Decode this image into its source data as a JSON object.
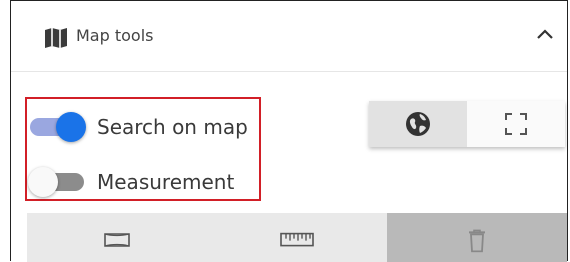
{
  "panel": {
    "title": "Map tools",
    "icon": "map-icon",
    "collapse_icon": "chevron-up-icon"
  },
  "toggles": [
    {
      "label": "Search on map",
      "state": "on"
    },
    {
      "label": "Measurement",
      "state": "off"
    }
  ],
  "view_buttons": [
    {
      "icon": "globe-icon",
      "selected": true
    },
    {
      "icon": "fullscreen-icon",
      "selected": false
    }
  ],
  "tool_buttons": [
    {
      "icon": "map-outline-icon",
      "selected": false
    },
    {
      "icon": "ruler-icon",
      "selected": false
    },
    {
      "icon": "trash-icon",
      "selected": true
    }
  ],
  "colors": {
    "accent": "#1a73e8",
    "track_on": "#9aa7e0",
    "highlight": "#d21f27"
  }
}
